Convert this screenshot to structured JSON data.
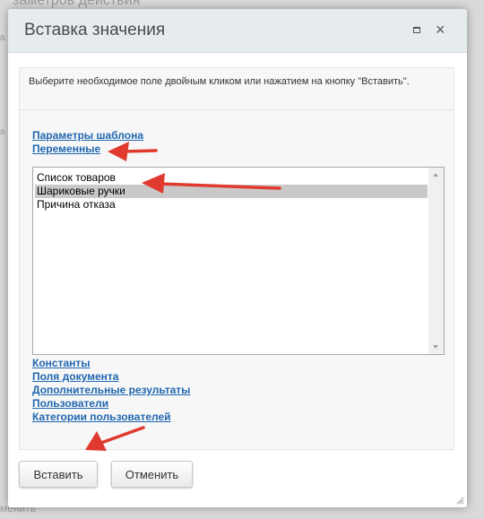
{
  "background": {
    "top_text": "заметров действия",
    "bottom_text": "менить",
    "right_marks": [
      "а",
      "а"
    ]
  },
  "dialog": {
    "title": "Вставка значения",
    "hint": "Выберите необходимое поле двойным кликом или нажатием на кнопку \"Вставить\".",
    "links_top": [
      "Параметры шаблона",
      "Переменные"
    ],
    "list_items": [
      "Список товаров",
      "Шариковые ручки",
      "Причина отказа"
    ],
    "selected_index": 1,
    "links_bottom": [
      "Константы",
      "Поля документа",
      "Дополнительные результаты",
      "Пользователи",
      "Категории пользователей"
    ],
    "buttons": {
      "insert": "Вставить",
      "cancel": "Отменить"
    }
  },
  "colors": {
    "link": "#2067b0",
    "annotation_arrow": "#e03a2f",
    "selected_row": "#c9c9c9",
    "title_bar": "#e6ecee"
  },
  "icons": [
    "maximize-icon",
    "close-icon",
    "scroll-up-icon",
    "scroll-down-icon",
    "resize-grip-icon"
  ]
}
